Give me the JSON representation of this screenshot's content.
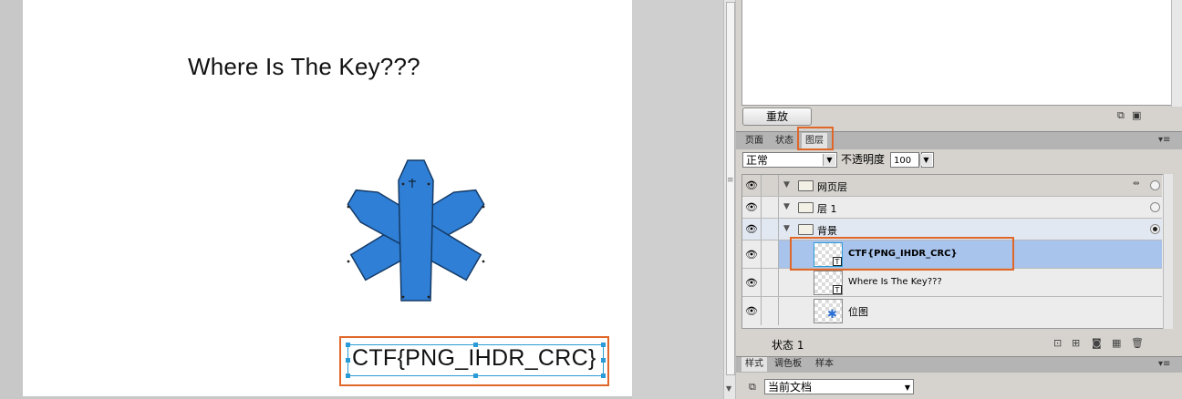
{
  "canvas": {
    "title_text": "Where Is The Key???",
    "ctf_text": "CTF{PNG_IHDR_CRC}"
  },
  "history_panel": {
    "replay_button": "重放"
  },
  "top_tabs": [
    {
      "label": "页面"
    },
    {
      "label": "状态"
    },
    {
      "label": "图层"
    }
  ],
  "layers_panel": {
    "blend_mode": "正常",
    "opacity_label": "不透明度",
    "opacity_value": "100",
    "rows": [
      {
        "name": "网页层"
      },
      {
        "name": "层 1"
      },
      {
        "name": "背景"
      },
      {
        "name": "CTF{PNG_IHDR_CRC}"
      },
      {
        "name": "Where Is The Key???"
      },
      {
        "name": "位图"
      }
    ],
    "status": "状态 1"
  },
  "bottom_tabs": [
    {
      "label": "样式"
    },
    {
      "label": "调色板"
    },
    {
      "label": "样本"
    }
  ],
  "styles_panel": {
    "document_select": "当前文档"
  },
  "colors": {
    "highlight": "#e0672a",
    "selection": "#2a9bd6",
    "coffin_blue": "#2f7fd6"
  },
  "icons": [
    "eye-icon",
    "folder-icon",
    "text-layer-icon",
    "bitmap-icon",
    "trash-icon",
    "new-layer-icon",
    "panel-menu-icon"
  ]
}
